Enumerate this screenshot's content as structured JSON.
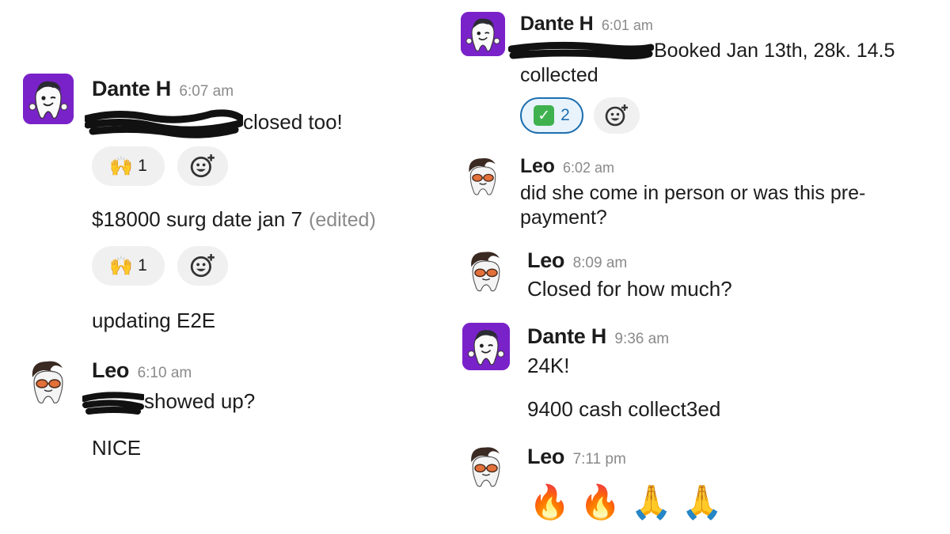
{
  "left_messages": {
    "dante_1": {
      "author": "Dante H",
      "time": "6:07 am",
      "text": "closed too!",
      "reaction": {
        "emoji": "🙌",
        "count": "1"
      },
      "text_2": "$18000 surg date jan 7",
      "edited": "(edited)",
      "reaction_2": {
        "emoji": "🙌",
        "count": "1"
      },
      "text_3": "updating E2E"
    },
    "leo_1": {
      "author": "Leo",
      "time": "6:10 am",
      "text": "showed up?",
      "text_2": "NICE"
    }
  },
  "right_messages": {
    "dante_1": {
      "author": "Dante H",
      "time": "6:01 am",
      "text_line1": "Booked Jan 13th, 28k. 14.5",
      "text_line2": "collected",
      "reaction": {
        "emoji": "✓",
        "count": "2"
      }
    },
    "leo_1": {
      "author": "Leo",
      "time": "6:02 am",
      "text_line1": "did she come in person or was this pre-",
      "text_line2": "payment?"
    },
    "leo_2": {
      "author": "Leo",
      "time": "8:09 am",
      "text": "Closed for how much?"
    },
    "dante_2": {
      "author": "Dante H",
      "time": "9:36 am",
      "text": "24K!",
      "text_2": "9400 cash collect3ed"
    },
    "leo_3": {
      "author": "Leo",
      "time": "7:11 pm",
      "text": "🔥🔥🙏🙏"
    }
  },
  "colors": {
    "dante_avatar_bg": "#7a22c9",
    "selected_reaction_border": "#1d6fb0",
    "reaction_bg": "#f0f0f0",
    "timestamp": "#8a8a8a"
  },
  "icons": {
    "add_reaction": "add-reaction-icon",
    "dante_avatar": "tooth-character-avatar",
    "leo_avatar": "tooth-character-sunglasses-avatar"
  }
}
